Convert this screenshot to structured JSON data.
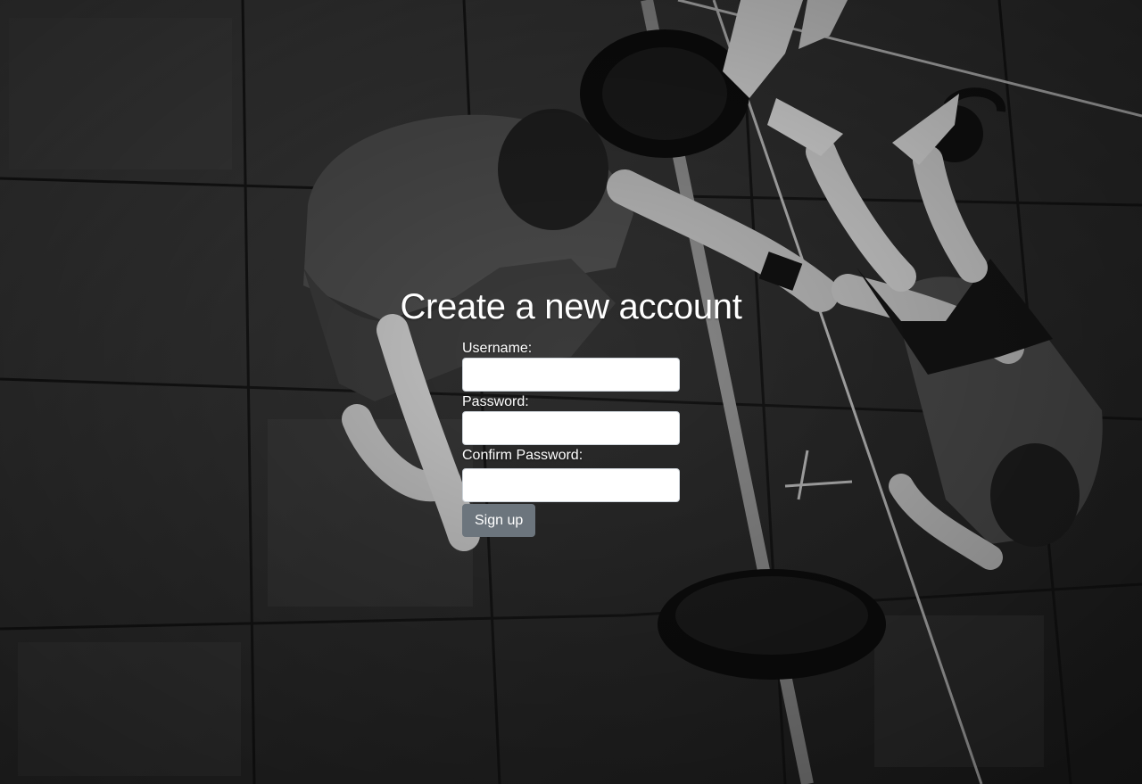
{
  "page": {
    "title": "Create a new account"
  },
  "form": {
    "username_label": "Username:",
    "username_value": "",
    "password_label": "Password:",
    "password_value": "",
    "confirm_password_label": "Confirm Password:",
    "confirm_password_value": "",
    "submit_label": "Sign up"
  },
  "colors": {
    "button_bg": "#6c757d",
    "title_text": "#ffffff",
    "input_border": "#ced4da"
  },
  "background": {
    "icon": "gym-photo-background"
  }
}
